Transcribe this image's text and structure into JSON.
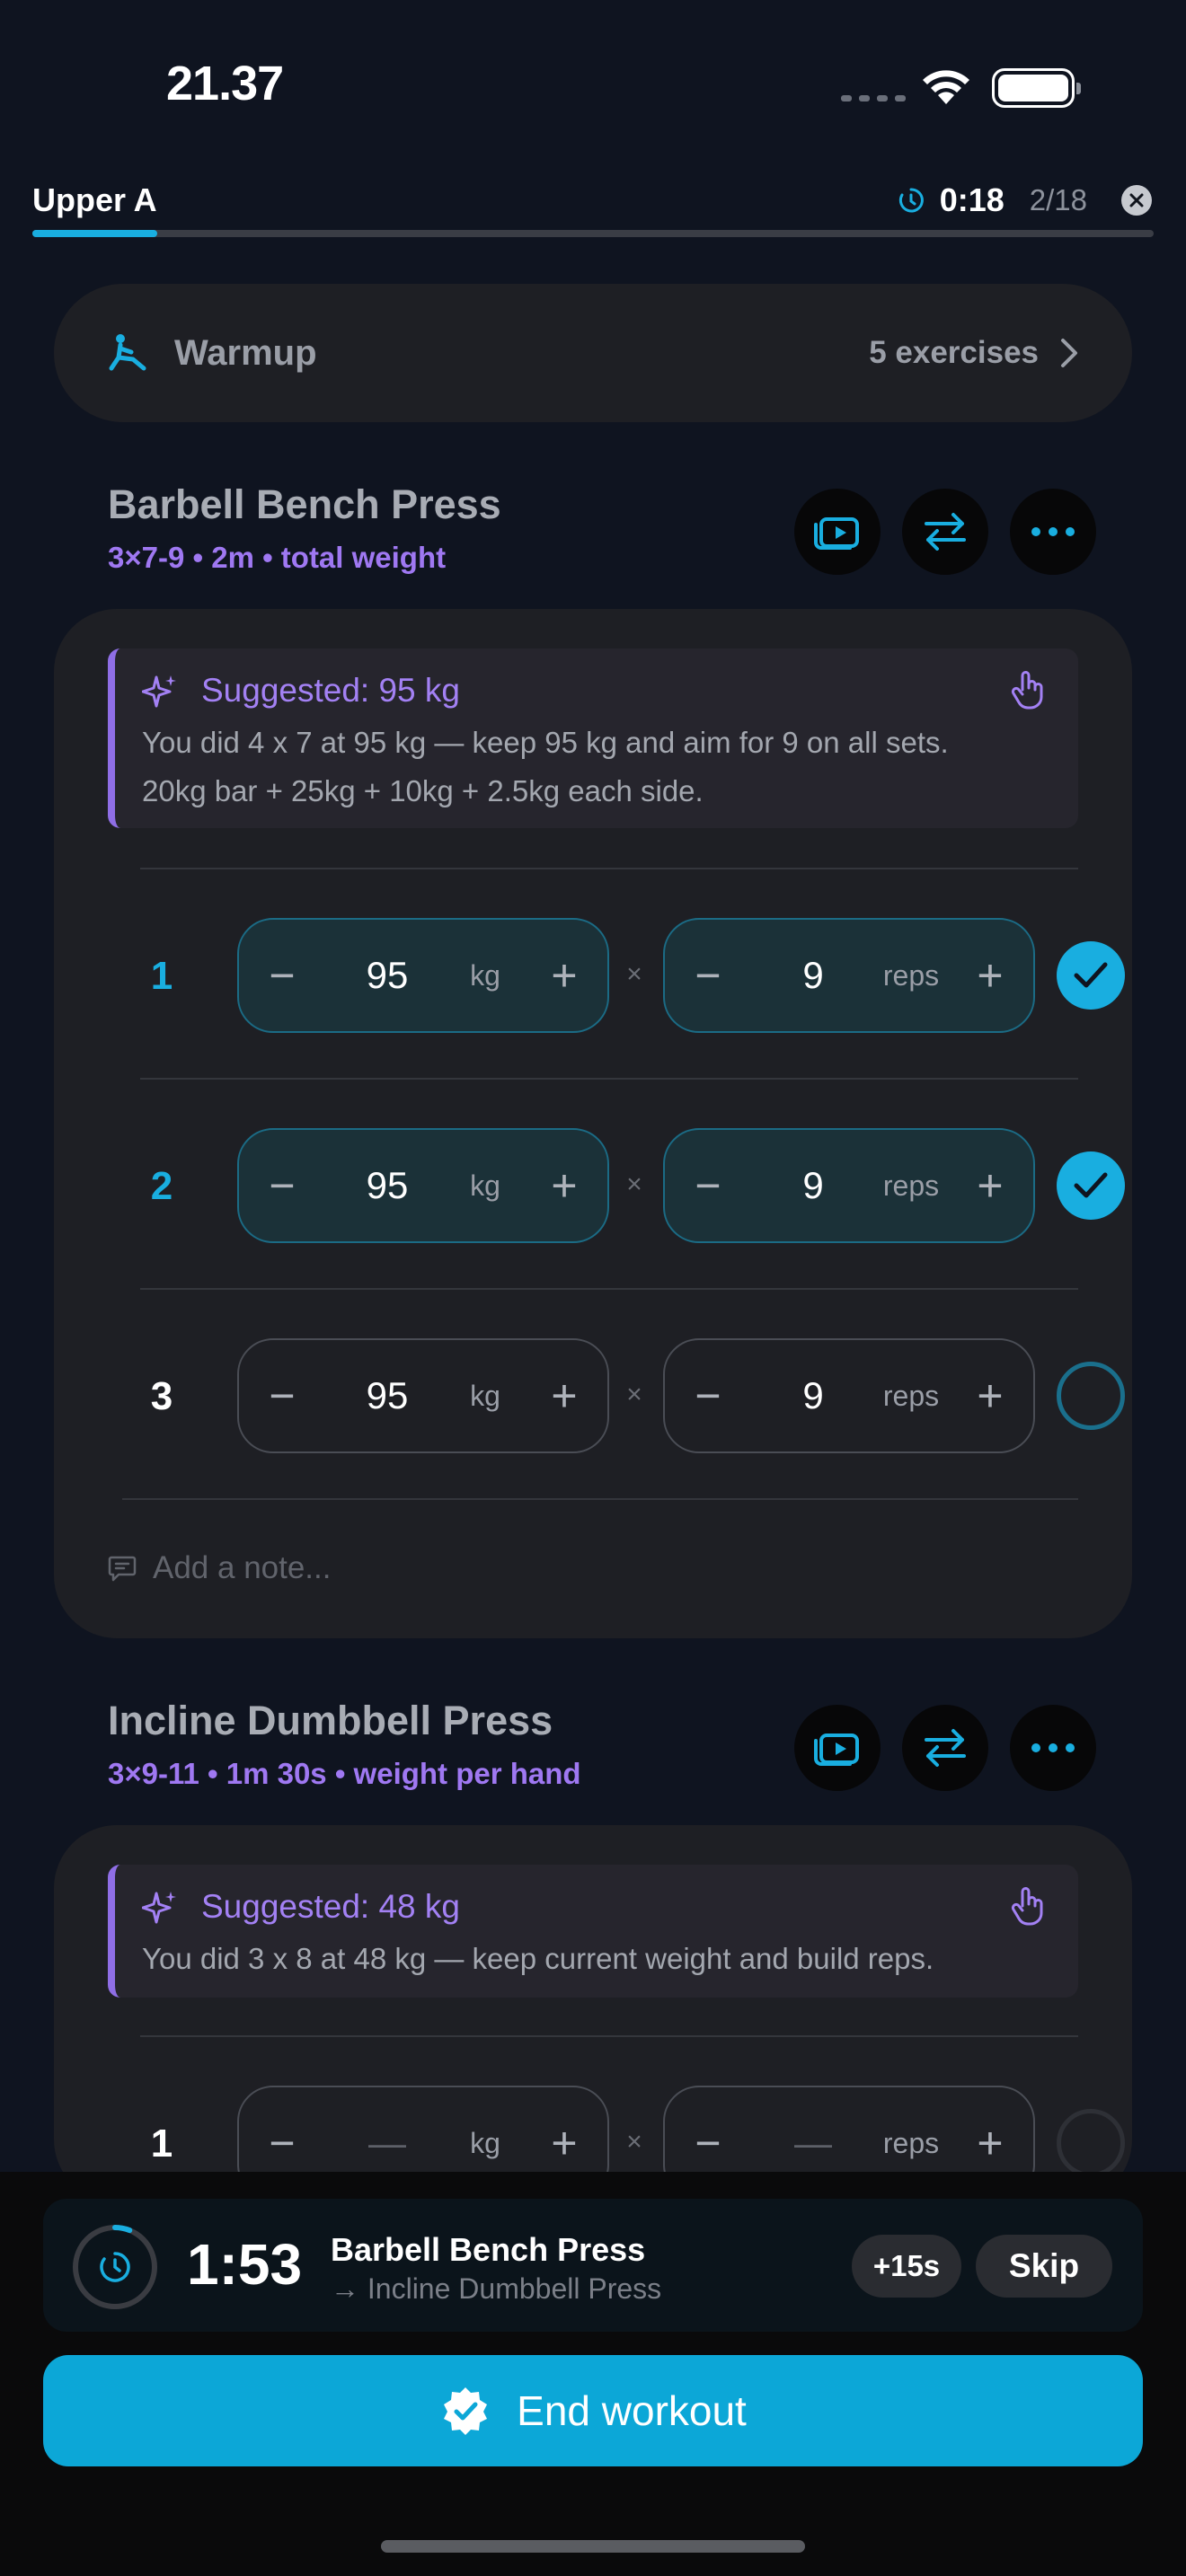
{
  "status": {
    "time": "21.37"
  },
  "header": {
    "workout_name": "Upper A",
    "elapsed": "0:18",
    "set_progress": "2/18",
    "progress_fraction": 0.111
  },
  "warmup": {
    "title": "Warmup",
    "count": "5 exercises"
  },
  "exercises": [
    {
      "name": "Barbell Bench Press",
      "meta": "3×7-9 • 2m • total weight",
      "suggestion": {
        "title": "Suggested: 95 kg",
        "line1": "You did 4 x 7 at 95 kg — keep 95 kg and aim for 9 on all sets.",
        "line2": "20kg bar + 25kg + 10kg + 2.5kg each side."
      },
      "sets": [
        {
          "number": "1",
          "weight": "95",
          "weight_unit": "kg",
          "reps": "9",
          "reps_unit": "reps",
          "completed": true
        },
        {
          "number": "2",
          "weight": "95",
          "weight_unit": "kg",
          "reps": "9",
          "reps_unit": "reps",
          "completed": true
        },
        {
          "number": "3",
          "weight": "95",
          "weight_unit": "kg",
          "reps": "9",
          "reps_unit": "reps",
          "completed": false
        }
      ],
      "note_placeholder": "Add a note..."
    },
    {
      "name": "Incline Dumbbell Press",
      "meta": "3×9-11 • 1m 30s • weight per hand",
      "suggestion": {
        "title": "Suggested: 48 kg",
        "line1": "You did 3 x 8 at 48 kg — keep current weight and build reps."
      },
      "sets": [
        {
          "number": "1",
          "weight": "—",
          "weight_unit": "kg",
          "reps": "—",
          "reps_unit": "reps",
          "completed": false
        }
      ]
    }
  ],
  "controls": {
    "minus": "−",
    "plus": "+",
    "times": "×"
  },
  "rest_timer": {
    "time": "1:53",
    "exercise": "Barbell Bench Press",
    "next": "→ Incline Dumbbell Press",
    "add_label": "+15s",
    "skip_label": "Skip",
    "progress_fraction": 0.06
  },
  "end_workout_label": "End workout",
  "colors": {
    "accent": "#19aee0",
    "purple": "#9f78f2",
    "end_button": "#0ca7d7"
  }
}
